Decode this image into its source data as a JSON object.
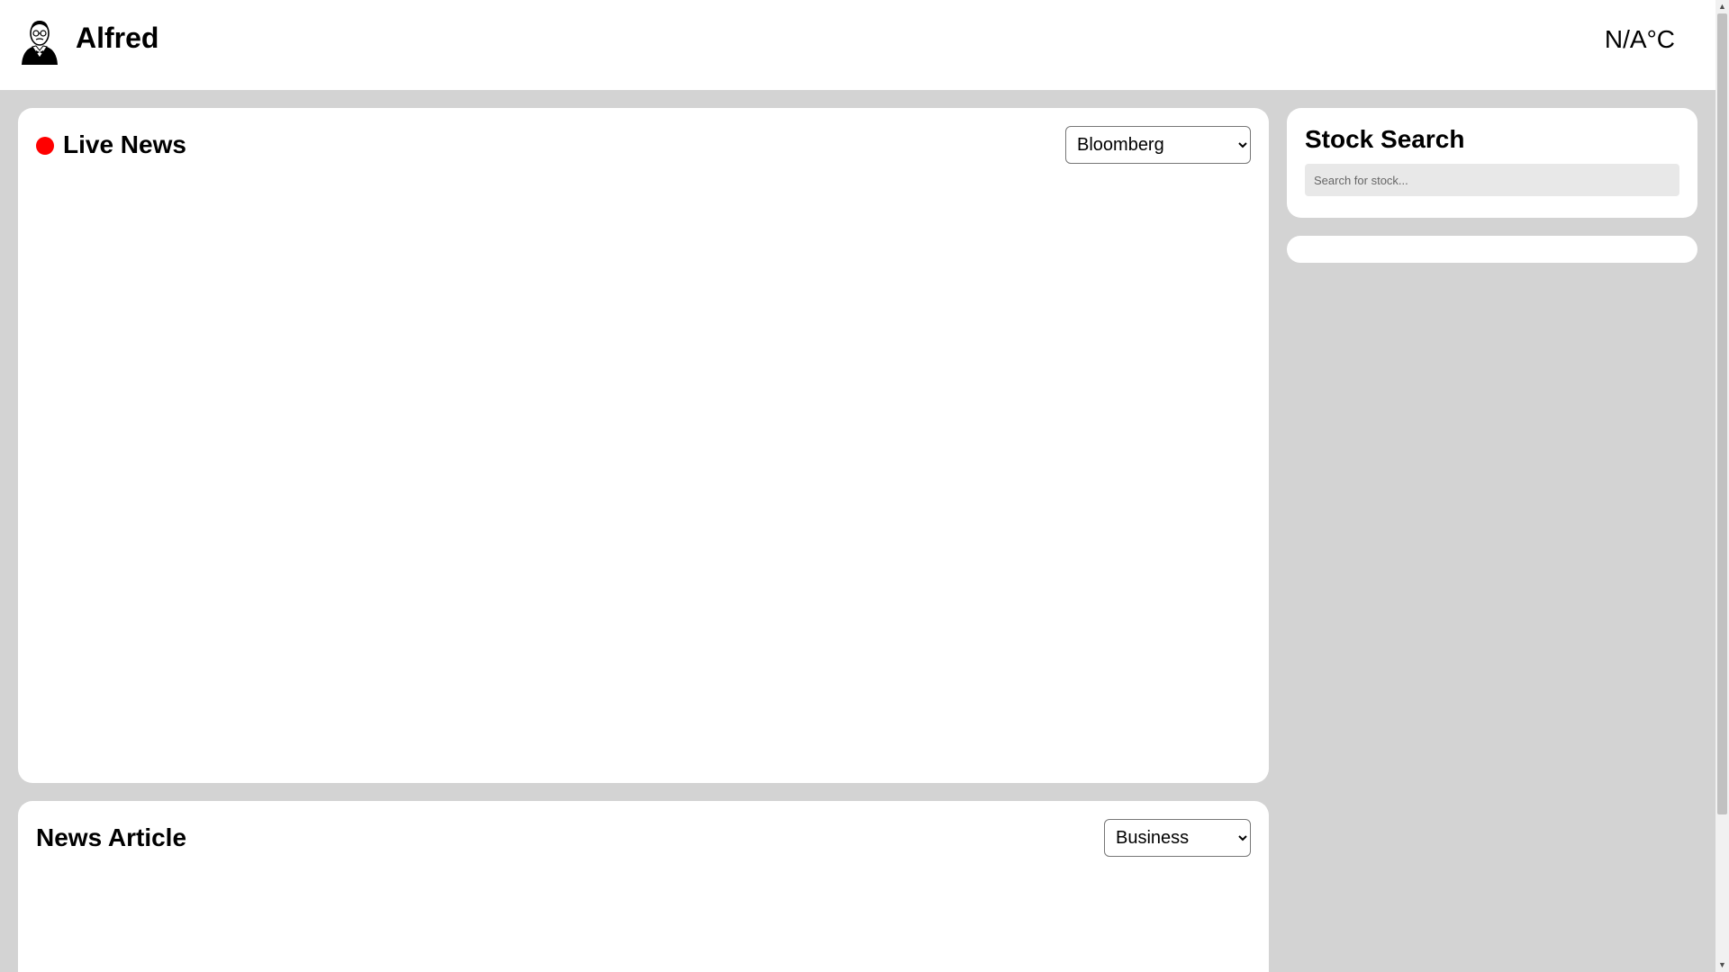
{
  "header": {
    "app_title": "Alfred",
    "logo_icon": "butler-icon",
    "weather": "N/A°C"
  },
  "live_news": {
    "title": "Live News",
    "status_color": "#ff0000",
    "selected_source": "Bloomberg"
  },
  "news_article": {
    "title": "News Article",
    "selected_category": "Business"
  },
  "stock_search": {
    "title": "Stock Search",
    "placeholder": "Search for stock..."
  },
  "colors": {
    "background": "#d3d3d3",
    "card": "#ffffff",
    "live_indicator": "#ff0000"
  }
}
